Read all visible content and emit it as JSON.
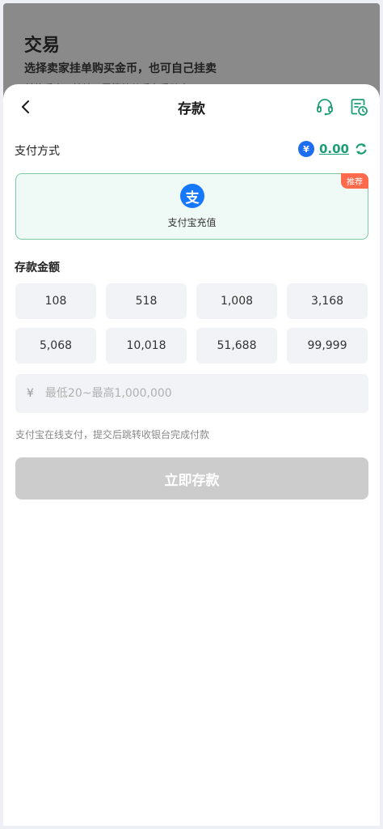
{
  "background": {
    "title": "交易",
    "subtitle": "选择卖家挂单购买金币，也可自己挂卖",
    "subtitle2": "付款后人工核认，需等待从后台手动审"
  },
  "header": {
    "title": "存款",
    "back_icon": "chevron-left-icon",
    "support_icon": "headset-icon",
    "history_icon": "document-clock-icon"
  },
  "payment": {
    "label": "支付方式",
    "balance_currency_symbol": "¥",
    "balance": "0.00",
    "accent_color": "#1d9e74"
  },
  "method": {
    "logo_char": "支",
    "name": "支付宝充值",
    "badge": "推荐"
  },
  "amount": {
    "title": "存款金额",
    "options": [
      "108",
      "518",
      "1,008",
      "3,168",
      "5,068",
      "10,018",
      "51,688",
      "99,999"
    ],
    "currency_sign": "¥",
    "placeholder": "最低20~最高1,000,000"
  },
  "hint": "支付宝在线支付，提交后跳转收银台完成付款",
  "submit_label": "立即存款"
}
